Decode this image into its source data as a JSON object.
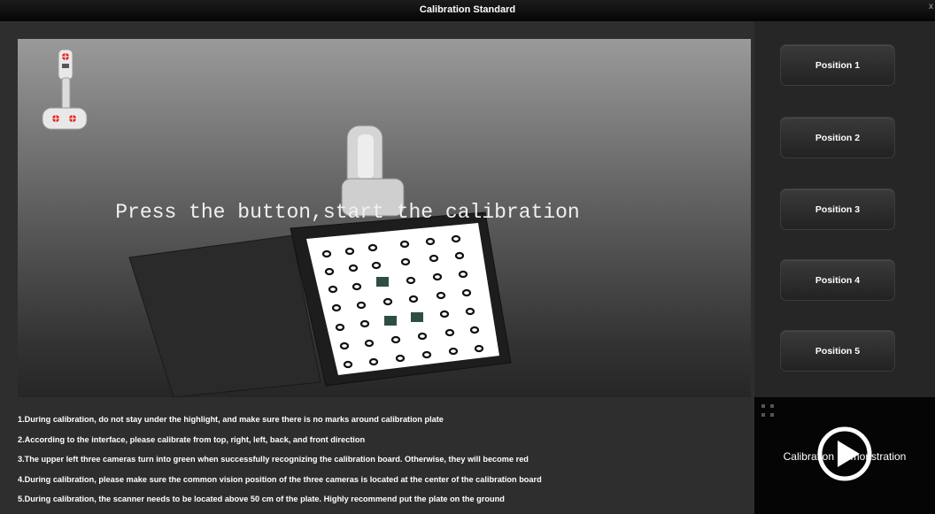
{
  "window": {
    "title": "Calibration Standard",
    "close_label": "x"
  },
  "viewport": {
    "prompt": "Press the button,start the calibration"
  },
  "instructions": [
    "1.During calibration, do not stay under the highlight, and make sure there is no marks around calibration plate",
    "2.According to the interface, please calibrate from top, right, left, back, and front direction",
    "3.The upper left three cameras turn into green when successfully recognizing the calibration board. Otherwise, they will become red",
    "4.During calibration, please make sure the common vision position of the three cameras is located at the center of the calibration board",
    "5.During calibration, the scanner needs to be located above 50 cm of the plate. Highly recommend put the plate on the ground"
  ],
  "positions": [
    {
      "label": "Position 1"
    },
    {
      "label": "Position 2"
    },
    {
      "label": "Position 3"
    },
    {
      "label": "Position 4"
    },
    {
      "label": "Position 5"
    }
  ],
  "video": {
    "label": "Calibration Demonstration",
    "play_icon": "play-icon",
    "fullscreen_icon": "fullscreen-icon"
  },
  "cameras": {
    "status_color": "#e02020",
    "count": 3
  }
}
